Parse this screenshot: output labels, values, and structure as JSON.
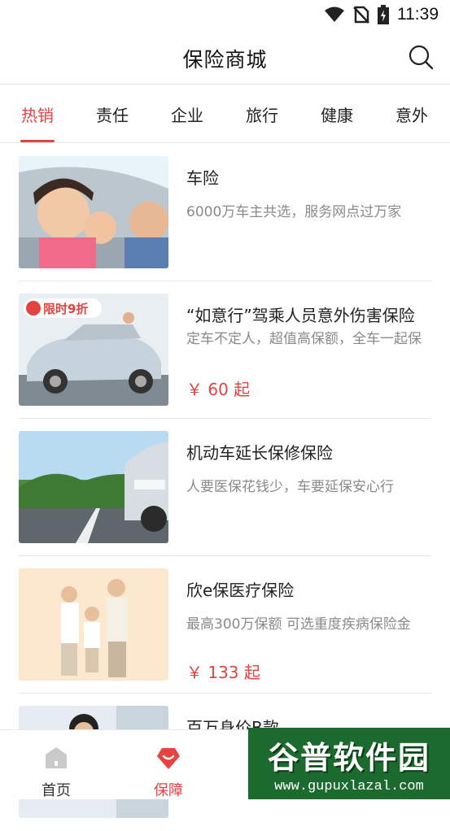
{
  "status_bar": {
    "time": "11:39"
  },
  "header": {
    "title": "保险商城"
  },
  "tabs": [
    {
      "label": "热销",
      "active": true
    },
    {
      "label": "责任",
      "active": false
    },
    {
      "label": "企业",
      "active": false
    },
    {
      "label": "旅行",
      "active": false
    },
    {
      "label": "健康",
      "active": false
    },
    {
      "label": "意外",
      "active": false
    }
  ],
  "products": [
    {
      "title": "车险",
      "desc": "6000万车主共选，服务网点过万家",
      "price": ""
    },
    {
      "title": "“如意行”驾乘人员意外伤害保险",
      "desc": "定车不定人，超值高保额，全车一起保",
      "price": "￥ 60 起",
      "badge": "限时9折"
    },
    {
      "title": "机动车延长保修保险",
      "desc": "人要医保花钱少，车要延保安心行",
      "price": ""
    },
    {
      "title": "欣e保医疗保险",
      "desc": "最高300万保额 可选重度疾病保险金",
      "price": "￥ 133 起"
    },
    {
      "title": "百万身价B款",
      "desc": "",
      "price": ""
    }
  ],
  "bottom_nav": [
    {
      "label": "首页",
      "icon": "home-icon",
      "active": false
    },
    {
      "label": "保障",
      "icon": "shield-icon",
      "active": true
    },
    {
      "label": "",
      "icon": "",
      "active": false
    },
    {
      "label": "",
      "icon": "",
      "active": false
    }
  ],
  "watermark": {
    "title": "谷普软件园",
    "url": "www.gupuxlazal.com"
  },
  "colors": {
    "accent": "#e64340",
    "text": "#222222",
    "muted": "#8a8a8a"
  }
}
